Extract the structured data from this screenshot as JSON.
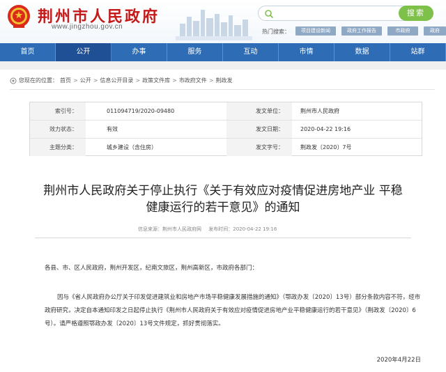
{
  "header": {
    "site_title": "荆州市人民政府",
    "site_url": "www.jingzhou.gov.cn",
    "search": {
      "placeholder": "",
      "button": "搜索"
    },
    "hot_label": "热门搜索：",
    "hot_tags": [
      "项目建设新闻",
      "政府工作报告",
      "市政府",
      "政府"
    ],
    "colors": {
      "title_red": "#c41a1a",
      "nav_blue": "#2e6db6",
      "search_green": "#7ec14a"
    }
  },
  "nav": {
    "items": [
      "首页",
      "公开",
      "办事",
      "服务",
      "互动",
      "市情",
      "数据",
      "站群"
    ],
    "active_index": 1
  },
  "breadcrumb": {
    "prefix": "您现在的位置：",
    "items": [
      "首页",
      "公开",
      "信息公开目录",
      "政策文件库",
      "市政府文件",
      "荆政发"
    ]
  },
  "meta": {
    "rows": [
      {
        "k1": "索引号：",
        "v1": "011094719/2020-09480",
        "k2": "发文单位：",
        "v2": "荆州市人民政府"
      },
      {
        "k1": "效力状态：",
        "v1": "有效",
        "k2": "发文日期：",
        "v2": "2020-04-22 19:16"
      },
      {
        "k1": "主题分类：",
        "v1": "城乡建设（含住房）",
        "k2": "发文字号：",
        "v2": "荆政发〔2020〕7号"
      }
    ]
  },
  "article": {
    "title_line1": "荆州市人民政府关于停止执行《关于有效应对疫情促进房地产业 平稳",
    "title_line2": "健康运行的若干意见》的通知",
    "source": "信息来源：荆州市人民政府网",
    "publish_time": "发布时间：2020-04-22 19:16",
    "salutation": "各县、市、区人民政府，荆州开发区，纪南文旅区，荆州高新区，市政府各部门：",
    "body": "因与《省人民政府办公厅关于印发促进建筑业和房地产市场平稳健康发展措施的通知》（鄂政办发〔2020〕13号）部分条款内容不符，经市政府研究，决定自本通知印发之日起停止执行《荆州市人民政府关于有效应对疫情促进房地产业平稳健康运行的若干意见》（荆政发〔2020〕6号）。请严格遵照鄂政办发〔2020〕13号文件规定，抓好贯彻落实。",
    "date": "2020年4月22日"
  }
}
